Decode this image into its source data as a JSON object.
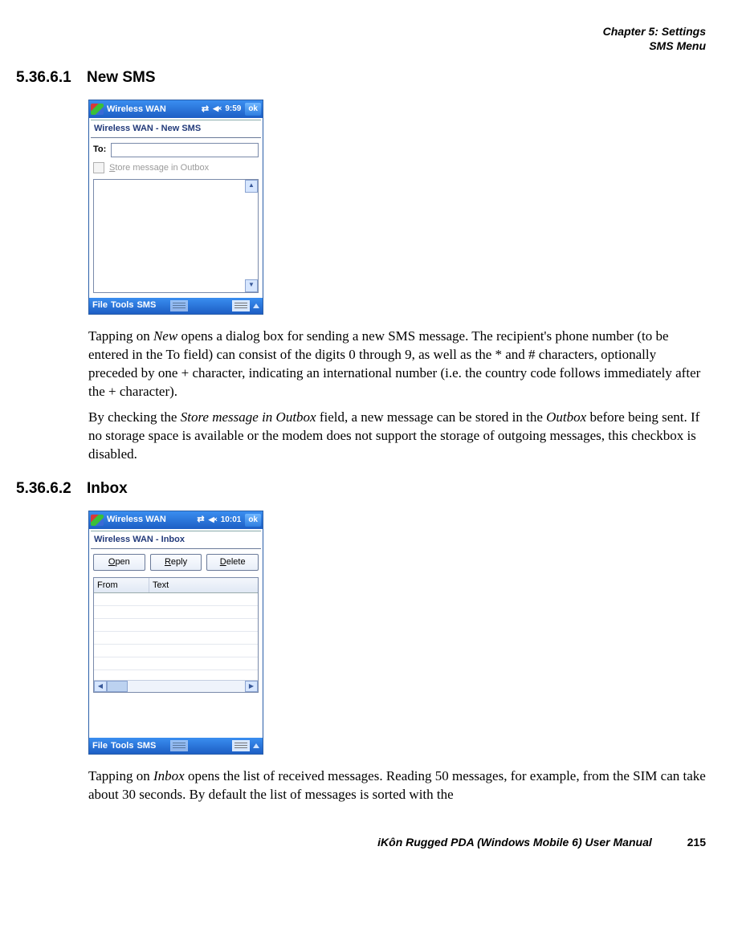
{
  "header": {
    "line1": "Chapter 5:  Settings",
    "line2": "SMS Menu"
  },
  "s1": {
    "num": "5.36.6.1",
    "title": "New SMS",
    "p1a": "Tapping on ",
    "p1b": "New",
    "p1c": " opens a dialog box for sending a new SMS message. The recipient's phone number (to be entered in the To field) can consist of the digits 0 through 9, as well as the * and # characters, optionally preceded by one + character, indicating an international number (i.e. the country code follows immediately after the + character).",
    "p2a": "By checking the ",
    "p2b": "Store message in Outbox",
    "p2c": " field, a new message can be stored in the ",
    "p2d": "Outbox",
    "p2e": " before being sent. If no storage space is available or the modem does not support the storage of outgoing messages, this checkbox is disabled."
  },
  "s2": {
    "num": "5.36.6.2",
    "title": "Inbox",
    "p1a": "Tapping on ",
    "p1b": "Inbox",
    "p1c": " opens the list of received messages. Reading 50 messages, for example, from the SIM can take about 30 seconds. By default the list of messages is sorted with the"
  },
  "shot1": {
    "tb_title": "Wireless WAN",
    "tb_time": "9:59",
    "tb_ok": "ok",
    "subtitle": "Wireless WAN - New SMS",
    "to_label": "To:",
    "store_a": "S",
    "store_b": "tore message in Outbox",
    "menu_file": "File",
    "menu_tools": "Tools",
    "menu_sms": "SMS"
  },
  "shot2": {
    "tb_title": "Wireless WAN",
    "tb_time": "10:01",
    "tb_ok": "ok",
    "subtitle": "Wireless WAN - Inbox",
    "btn_open_u": "O",
    "btn_open_r": "pen",
    "btn_reply_u": "R",
    "btn_reply_r": "eply",
    "btn_del_u": "D",
    "btn_del_r": "elete",
    "col_from": "From",
    "col_text": "Text",
    "menu_file": "File",
    "menu_tools": "Tools",
    "menu_sms": "SMS"
  },
  "footer": {
    "text": "iKôn Rugged PDA (Windows Mobile 6) User Manual",
    "page": "215"
  }
}
